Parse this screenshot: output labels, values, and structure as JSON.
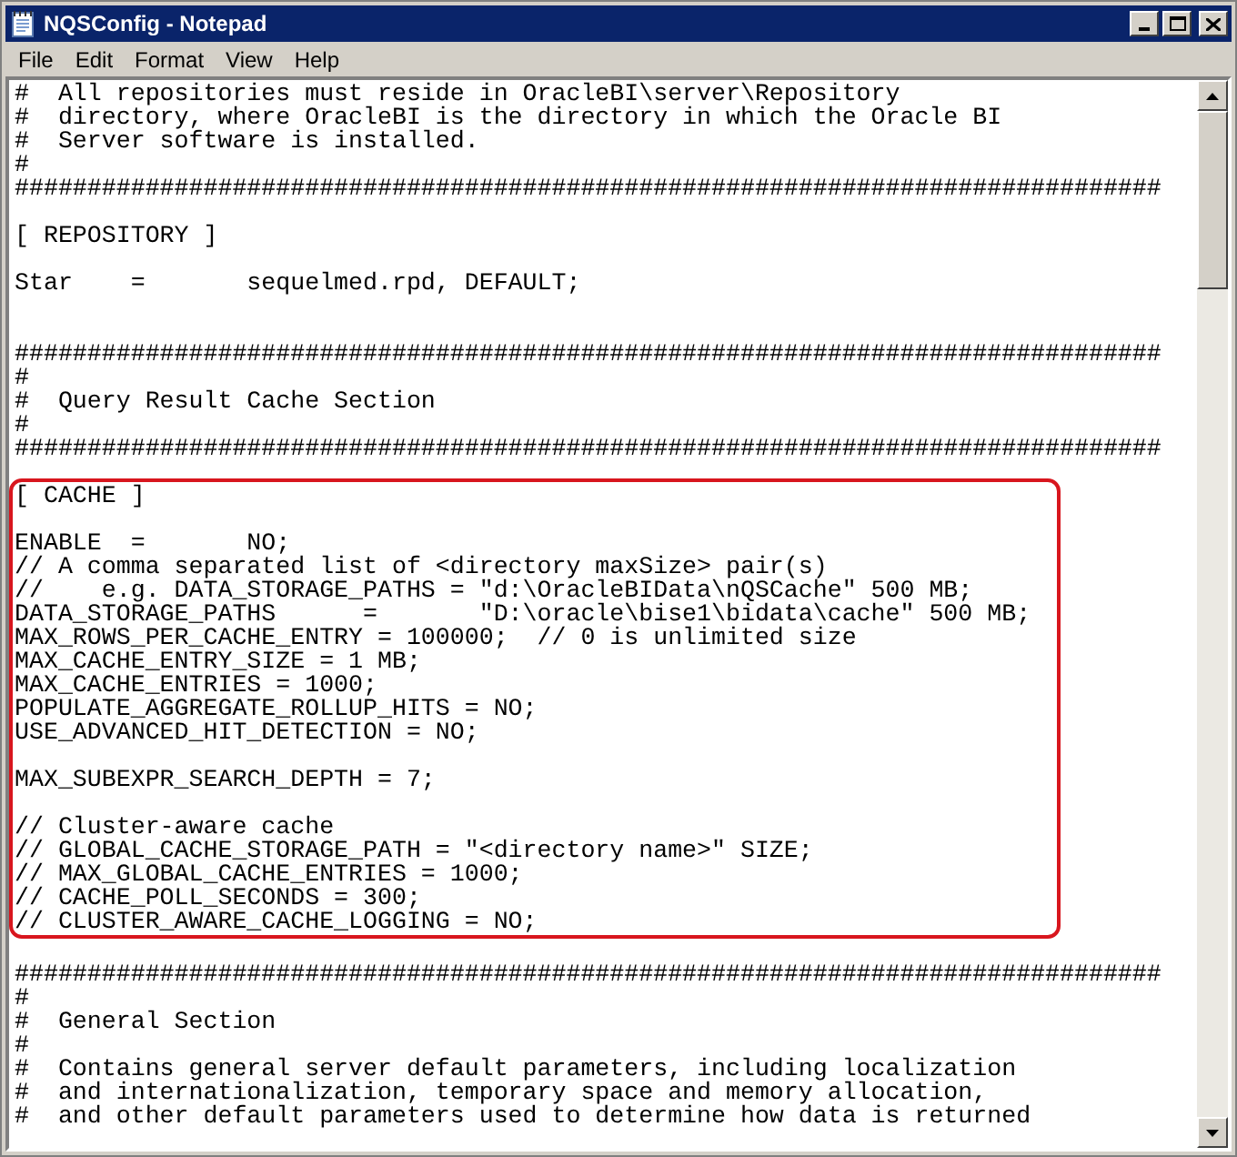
{
  "window": {
    "title": "NQSConfig - Notepad"
  },
  "menu": [
    "File",
    "Edit",
    "Format",
    "View",
    "Help"
  ],
  "editor": {
    "sections": [
      {
        "highlighted": false,
        "blocks": [
          {
            "kind": "paragraph",
            "lines": [
              "#  All repositories must reside in OracleBI\\server\\Repository",
              "#  directory, where OracleBI is the directory in which the Oracle BI",
              "#  Server software is installed.",
              "#",
              "###############################################################################"
            ]
          },
          {
            "kind": "paragraph",
            "lines": [
              "[ REPOSITORY ]"
            ]
          },
          {
            "kind": "paragraph",
            "lines": [
              "Star    =       sequelmed.rpd, DEFAULT;"
            ]
          },
          {
            "kind": "spaced-paragraph",
            "lines": [
              "###############################################################################",
              "#",
              "#  Query Result Cache Section",
              "#",
              "###############################################################################"
            ]
          }
        ]
      },
      {
        "highlighted": true,
        "blocks": [
          {
            "kind": "paragraph",
            "lines": [
              "[ CACHE ]"
            ]
          },
          {
            "kind": "paragraph",
            "lines": [
              "ENABLE  =       NO;",
              "// A comma separated list of <directory maxSize> pair(s)",
              "//    e.g. DATA_STORAGE_PATHS = \"d:\\OracleBIData\\nQSCache\" 500 MB;",
              "DATA_STORAGE_PATHS      =       \"D:\\oracle\\bise1\\bidata\\cache\" 500 MB;",
              "MAX_ROWS_PER_CACHE_ENTRY = 100000;  // 0 is unlimited size",
              "MAX_CACHE_ENTRY_SIZE = 1 MB;",
              "MAX_CACHE_ENTRIES = 1000;",
              "POPULATE_AGGREGATE_ROLLUP_HITS = NO;",
              "USE_ADVANCED_HIT_DETECTION = NO;"
            ]
          },
          {
            "kind": "paragraph",
            "lines": [
              "MAX_SUBEXPR_SEARCH_DEPTH = 7;"
            ]
          },
          {
            "kind": "paragraph",
            "lines": [
              "// Cluster-aware cache",
              "// GLOBAL_CACHE_STORAGE_PATH = \"<directory name>\" SIZE;",
              "// MAX_GLOBAL_CACHE_ENTRIES = 1000;",
              "// CACHE_POLL_SECONDS = 300;",
              "// CLUSTER_AWARE_CACHE_LOGGING = NO;"
            ]
          }
        ]
      },
      {
        "highlighted": false,
        "blocks": [
          {
            "kind": "paragraph",
            "lines": [
              "###############################################################################",
              "#",
              "#  General Section",
              "#",
              "#  Contains general server default parameters, including localization",
              "#  and internationalization, temporary space and memory allocation,",
              "#  and other default parameters used to determine how data is returned"
            ]
          }
        ]
      }
    ]
  }
}
